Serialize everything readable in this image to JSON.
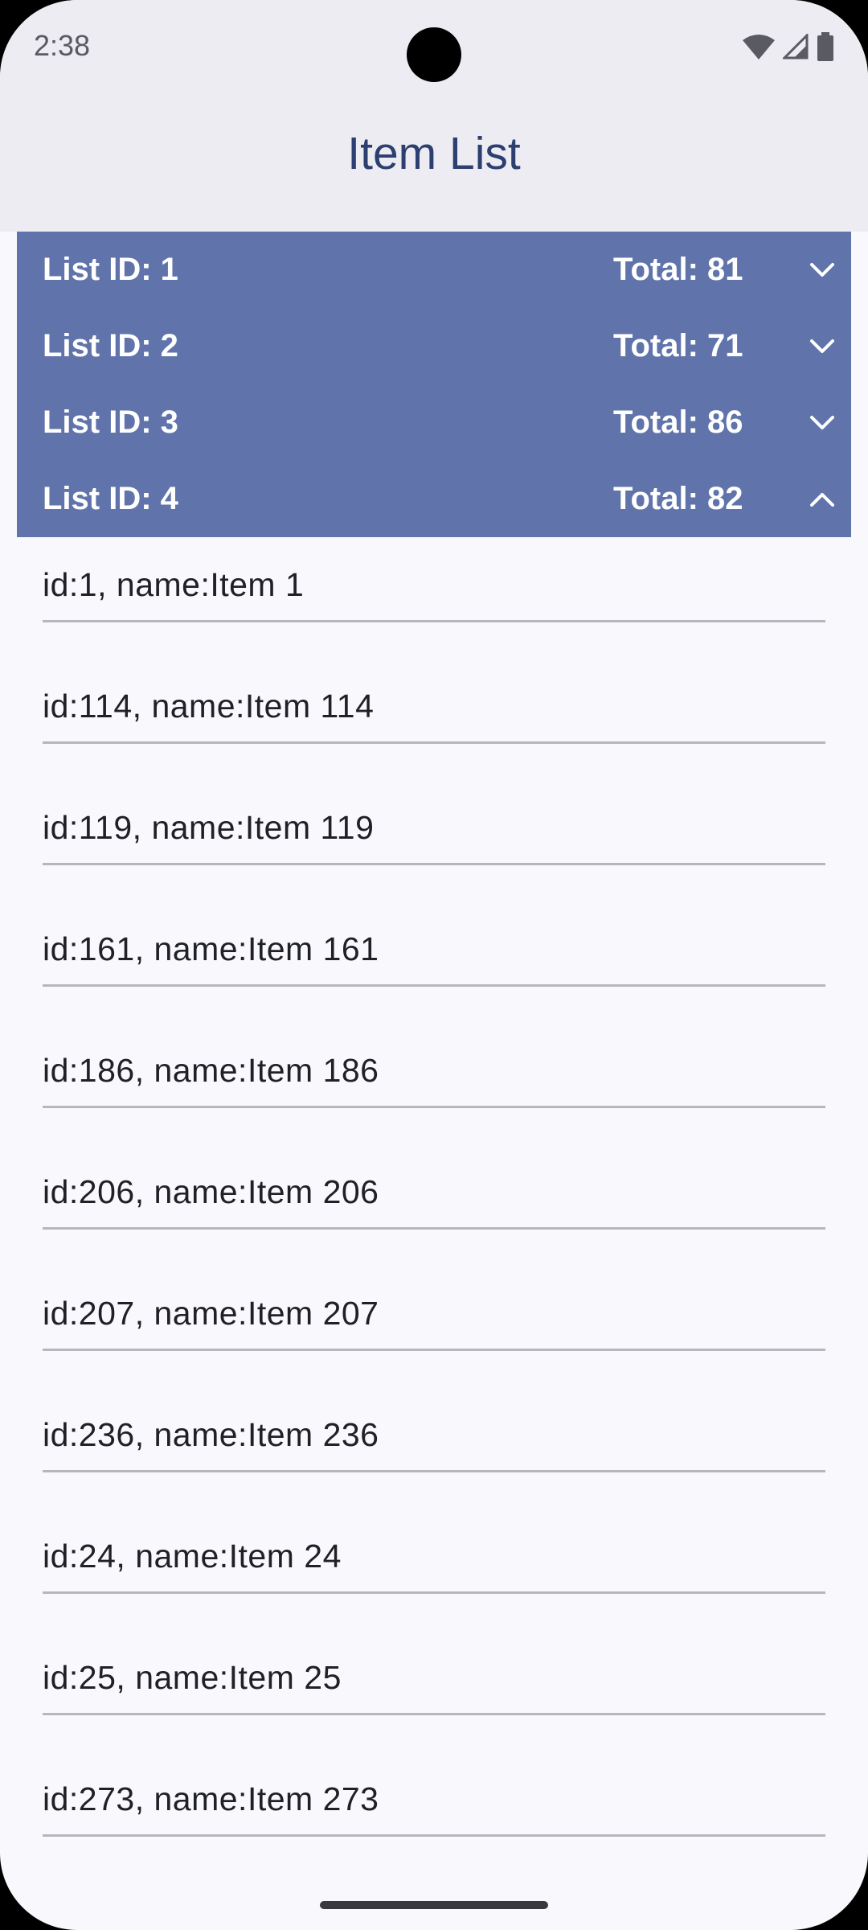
{
  "status_bar": {
    "time": "2:38",
    "icons": [
      "wifi-icon",
      "cell-signal-icon",
      "battery-icon"
    ]
  },
  "app_bar": {
    "title": "Item List"
  },
  "groups": [
    {
      "label": "List ID: 1",
      "total": "Total: 81",
      "expanded": false
    },
    {
      "label": "List ID: 2",
      "total": "Total: 71",
      "expanded": false
    },
    {
      "label": "List ID: 3",
      "total": "Total: 86",
      "expanded": false
    },
    {
      "label": "List ID: 4",
      "total": "Total: 82",
      "expanded": true
    }
  ],
  "items": [
    "id:1, name:Item 1",
    "id:114, name:Item 114",
    "id:119, name:Item 119",
    "id:161, name:Item 161",
    "id:186, name:Item 186",
    "id:206, name:Item 206",
    "id:207, name:Item 207",
    "id:236, name:Item 236",
    "id:24, name:Item 24",
    "id:25, name:Item 25",
    "id:273, name:Item 273"
  ],
  "colors": {
    "header_bg": "#6074ab",
    "title": "#2c3f70",
    "surface": "#f8f8fd",
    "app_bar_bg": "#edecf2"
  }
}
